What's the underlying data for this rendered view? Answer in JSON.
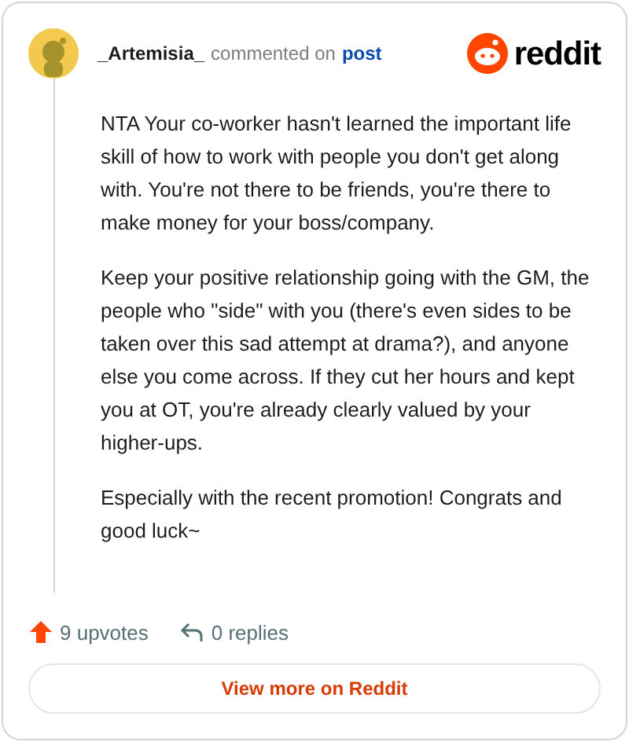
{
  "comment": {
    "author": "_Artemisia_",
    "action": "commented on",
    "target": "post",
    "paragraphs": [
      "NTA Your co-worker hasn't learned the important life skill of how to work with people you don't get along with. You're not there to be friends, you're there to make money for your boss/company.",
      "Keep your positive relationship going with the GM, the people who \"side\" with you (there's even sides to be taken over this sad attempt at drama?), and anyone else you come across. If they cut her hours and kept you at OT, you're already clearly valued by your higher-ups.",
      "Especially with the recent promotion! Congrats and good luck~"
    ],
    "upvotes": "9 upvotes",
    "replies": "0 replies"
  },
  "brand": "reddit",
  "button": "View more on Reddit"
}
